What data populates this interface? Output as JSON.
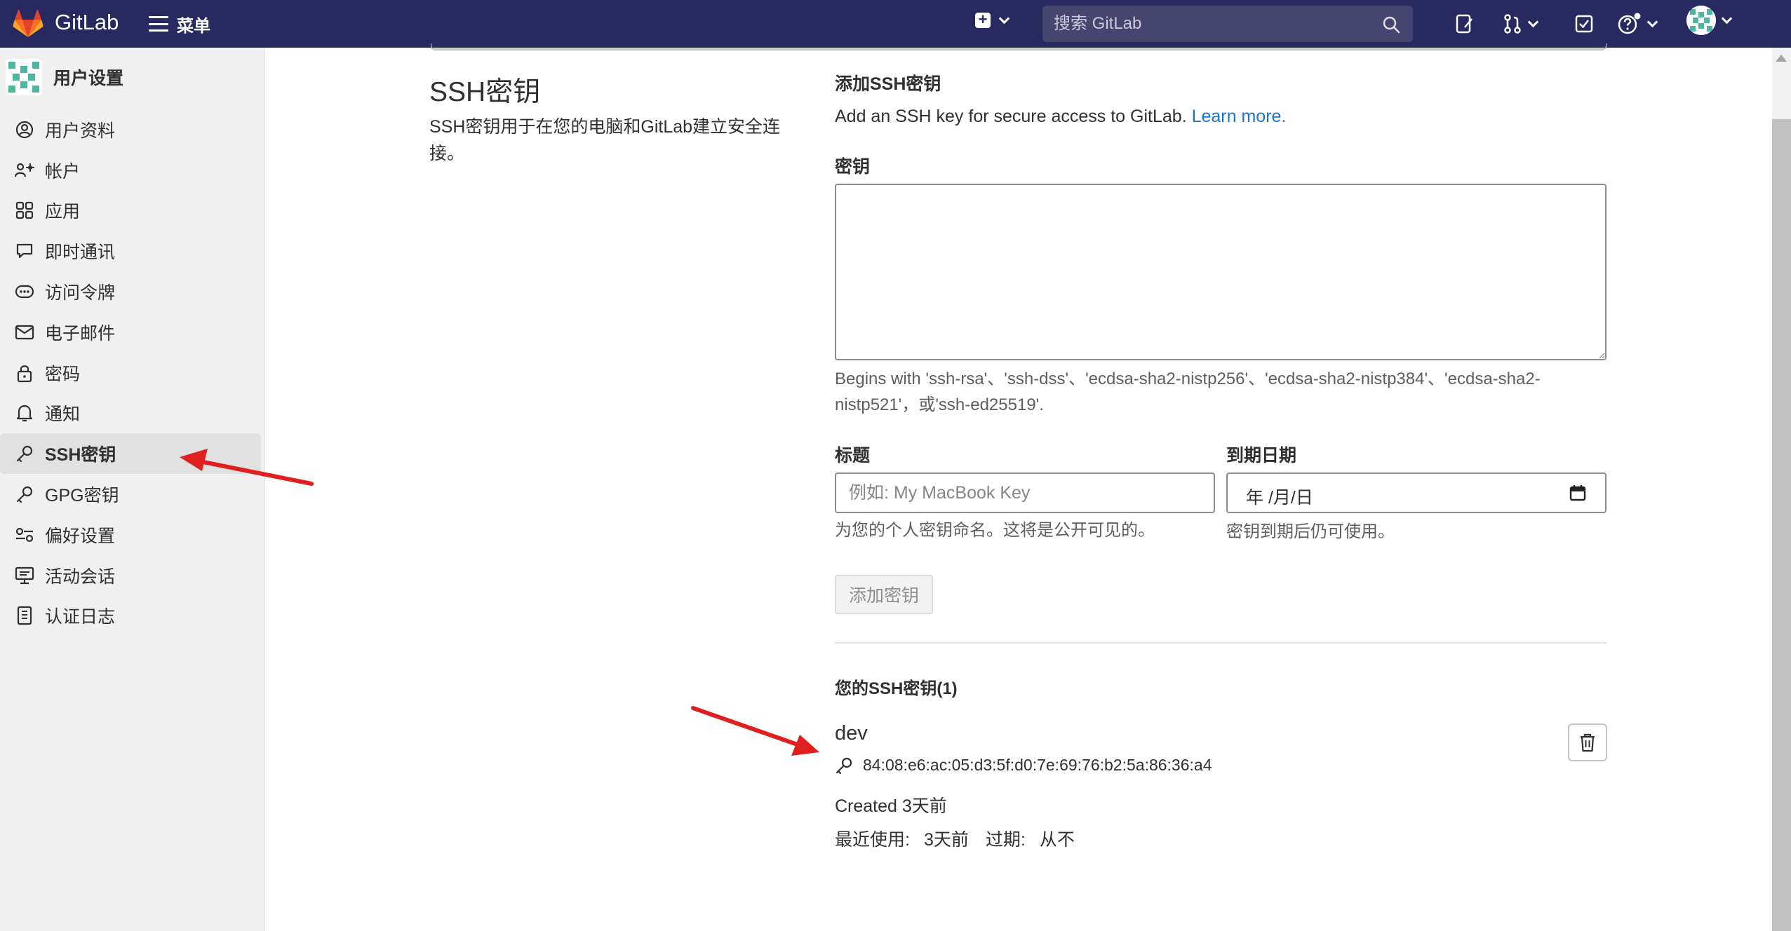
{
  "navbar": {
    "brand": "GitLab",
    "menu_label": "菜单",
    "search_placeholder": "搜索 GitLab"
  },
  "sidebar": {
    "title": "用户设置",
    "items": [
      {
        "label": "用户资料",
        "icon": "profile-icon"
      },
      {
        "label": "帐户",
        "icon": "account-icon"
      },
      {
        "label": "应用",
        "icon": "applications-icon"
      },
      {
        "label": "即时通讯",
        "icon": "chat-icon"
      },
      {
        "label": "访问令牌",
        "icon": "token-icon"
      },
      {
        "label": "电子邮件",
        "icon": "mail-icon"
      },
      {
        "label": "密码",
        "icon": "lock-icon"
      },
      {
        "label": "通知",
        "icon": "bell-icon"
      },
      {
        "label": "SSH密钥",
        "icon": "key-icon",
        "active": true
      },
      {
        "label": "GPG密钥",
        "icon": "key-icon"
      },
      {
        "label": "偏好设置",
        "icon": "preferences-icon"
      },
      {
        "label": "活动会话",
        "icon": "monitor-icon"
      },
      {
        "label": "认证日志",
        "icon": "log-icon"
      }
    ]
  },
  "section": {
    "title": "SSH密钥",
    "description": "SSH密钥用于在您的电脑和GitLab建立安全连接。"
  },
  "form": {
    "heading": "添加SSH密钥",
    "intro": "Add an SSH key for secure access to GitLab.",
    "learn_more": "Learn more.",
    "key_label": "密钥",
    "key_help_1": "Begins with 'ssh-rsa'、'ssh-dss'、'ecdsa-sha2-nistp256'、'ecdsa-sha2-nistp384'、'ecdsa-sha2-",
    "key_help_2": "nistp521'，或'ssh-ed25519'.",
    "title_label": "标题",
    "title_placeholder": "例如: My MacBook Key",
    "title_help": "为您的个人密钥命名。这将是公开可见的。",
    "expiry_label": "到期日期",
    "expiry_value": "年 /月/日",
    "expiry_help": "密钥到期后仍可使用。",
    "submit_label": "添加密钥"
  },
  "keys": {
    "heading": "您的SSH密钥(1)",
    "list": [
      {
        "name": "dev",
        "fingerprint": "84:08:e6:ac:05:d3:5f:d0:7e:69:76:b2:5a:86:36:a4",
        "created": "Created 3天前",
        "last_used_label": "最近使用:",
        "last_used": "3天前",
        "expires_label": "过期:",
        "expires": "从不"
      }
    ]
  },
  "colors": {
    "navbar": "#292961",
    "sidebar": "#f0f0f0",
    "link": "#1f75cb",
    "annotation_arrow": "#e02020"
  }
}
